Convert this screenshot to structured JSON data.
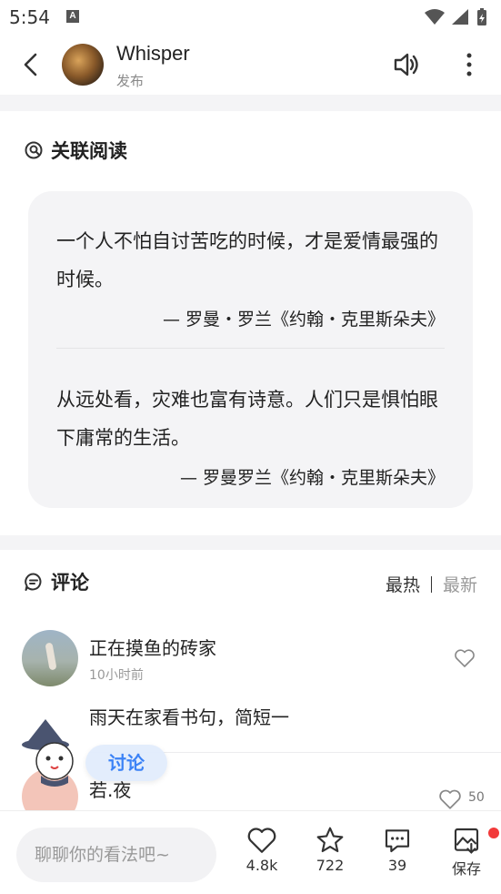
{
  "status_bar": {
    "time": "5:54",
    "notif_icon_letter": "A"
  },
  "header": {
    "name": "Whisper",
    "subtitle": "发布"
  },
  "related": {
    "title": "关联阅读",
    "quotes": [
      {
        "text": "一个人不怕自讨苦吃的时候，才是爱情最强的时候。",
        "author": "— 罗曼・罗兰《约翰・克里斯朵夫》"
      },
      {
        "text": "从远处看，灾难也富有诗意。人们只是惧怕眼下庸常的生活。",
        "author": "— 罗曼罗兰《约翰・克里斯朵夫》"
      }
    ]
  },
  "comments": {
    "title": "评论",
    "sort_hot": "最热",
    "sort_new": "最新",
    "items": [
      {
        "name": "正在摸鱼的砖家",
        "time": "10小时前",
        "text": "雨天在家看书句，简短一"
      },
      {
        "name": "若.夜",
        "likes": "50"
      }
    ]
  },
  "floating": {
    "discuss_label": "讨论"
  },
  "bottom_bar": {
    "input_placeholder": "聊聊你的看法吧~",
    "likes": "4.8k",
    "favorites": "722",
    "comments": "39",
    "save_label": "保存"
  },
  "colors": {
    "accent": "#3b82f6",
    "badge": "#f23a3a"
  }
}
